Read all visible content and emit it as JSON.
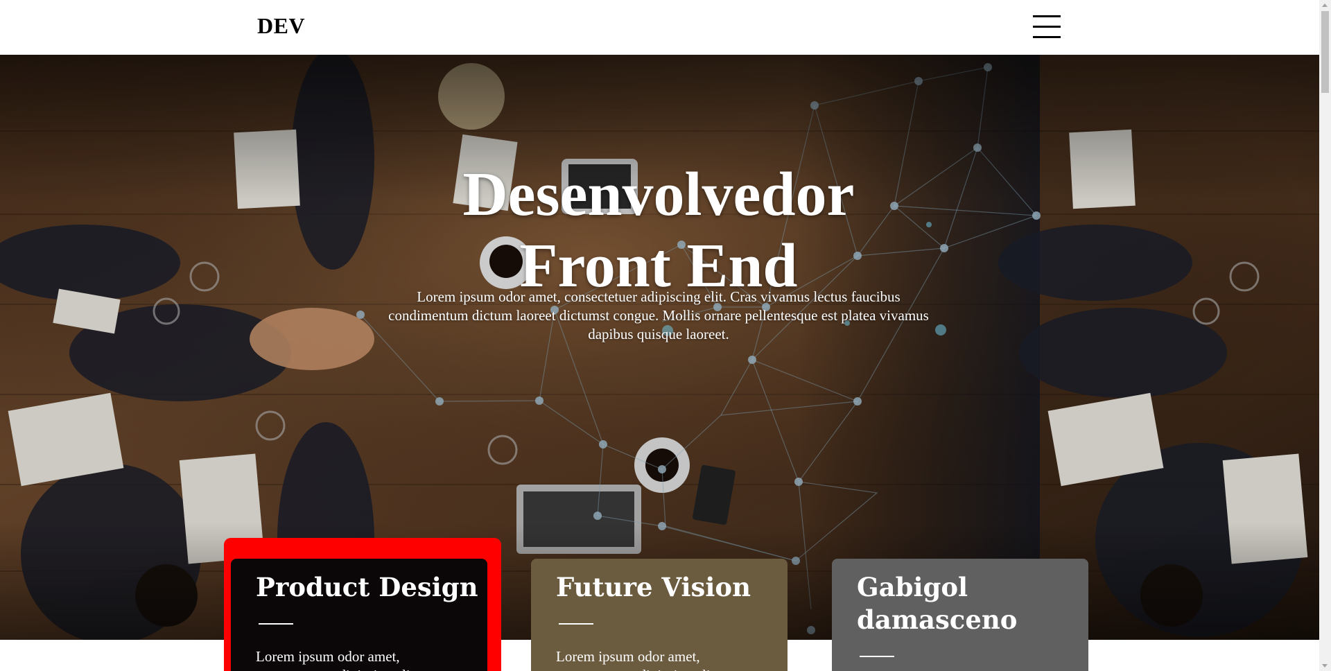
{
  "header": {
    "logo": "DEV",
    "menu_icon": "hamburger-menu-icon"
  },
  "hero": {
    "title_line1": "Desenvolvedor",
    "title_line2": "Front End",
    "text": "Lorem ipsum odor amet, consectetuer adipiscing elit. Cras vivamus lectus faucibus condimentum dictum laoreet dictumst congue. Mollis ornare pellentesque est platea vivamus dapibus quisque laoreet."
  },
  "cards": [
    {
      "title": "Product Design",
      "text": "Lorem ipsum odor amet, consectetuer adipiscing elit.",
      "color": "#0b0607",
      "frame_color": "#ff0000"
    },
    {
      "title": "Future Vision",
      "text": "Lorem ipsum odor amet, consectetuer adipiscing elit.",
      "color": "#6b5b3f"
    },
    {
      "title": "Gabigol damasceno",
      "color": "#606060"
    }
  ],
  "colors": {
    "accent_red": "#ff0000",
    "hero_wood": "#5a3a22",
    "network_line": "#8fb3c8"
  }
}
